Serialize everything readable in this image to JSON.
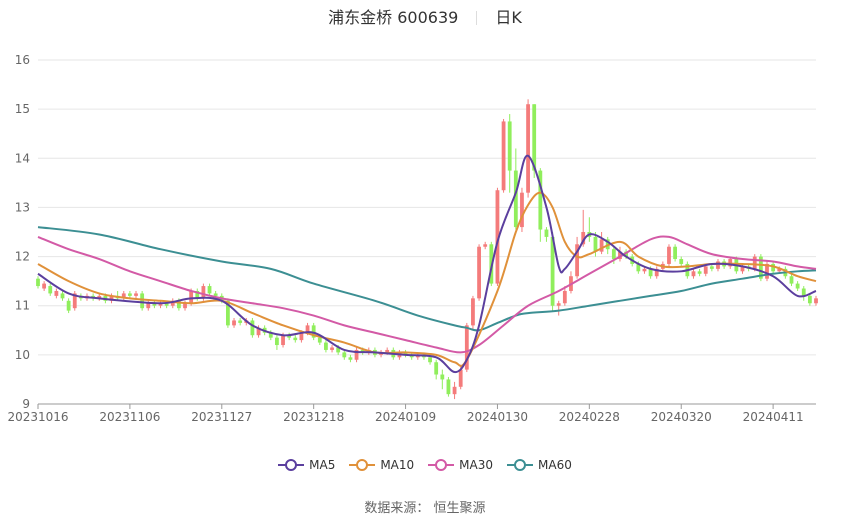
{
  "title": {
    "main": "浦东金桥 600639",
    "period": "日K"
  },
  "source_text": "数据来源： 恒生聚源",
  "colors": {
    "up": "#f47b7b",
    "down": "#90ee5c",
    "ma5": "#5b3f9e",
    "ma10": "#e0913a",
    "ma30": "#d35aa6",
    "ma60": "#3c8f93",
    "grid": "#e6e6e6"
  },
  "chart_data": {
    "type": "candlestick",
    "ylim": [
      9,
      16
    ],
    "yticks": [
      9,
      10,
      11,
      12,
      13,
      14,
      15,
      16
    ],
    "x_tick_labels": [
      "20231016",
      "20231106",
      "20231127",
      "20231218",
      "20240109",
      "20240130",
      "20240228",
      "20240320",
      "20240411"
    ],
    "x_tick_index": [
      0,
      15,
      30,
      45,
      60,
      75,
      90,
      105,
      120
    ],
    "legend": [
      "MA5",
      "MA10",
      "MA30",
      "MA60"
    ],
    "ohlc": [
      [
        11.55,
        11.4,
        11.6,
        11.35
      ],
      [
        11.35,
        11.45,
        11.5,
        11.3
      ],
      [
        11.4,
        11.25,
        11.45,
        11.2
      ],
      [
        11.2,
        11.3,
        11.35,
        11.15
      ],
      [
        11.25,
        11.15,
        11.3,
        11.1
      ],
      [
        11.1,
        10.9,
        11.15,
        10.85
      ],
      [
        10.95,
        11.25,
        11.3,
        10.9
      ],
      [
        11.2,
        11.15,
        11.25,
        11.1
      ],
      [
        11.15,
        11.2,
        11.25,
        11.1
      ],
      [
        11.2,
        11.15,
        11.25,
        11.1
      ],
      [
        11.15,
        11.2,
        11.25,
        11.1
      ],
      [
        11.2,
        11.1,
        11.25,
        11.05
      ],
      [
        11.1,
        11.2,
        11.25,
        11.05
      ],
      [
        11.2,
        11.15,
        11.3,
        11.1
      ],
      [
        11.15,
        11.25,
        11.3,
        11.1
      ],
      [
        11.25,
        11.2,
        11.3,
        11.15
      ],
      [
        11.2,
        11.25,
        11.3,
        11.15
      ],
      [
        11.25,
        10.95,
        11.3,
        10.9
      ],
      [
        10.95,
        11.05,
        11.1,
        10.9
      ],
      [
        11.05,
        11.0,
        11.1,
        10.95
      ],
      [
        11.0,
        11.05,
        11.1,
        10.95
      ],
      [
        11.05,
        11.0,
        11.1,
        10.95
      ],
      [
        11.0,
        11.1,
        11.15,
        10.95
      ],
      [
        11.1,
        10.95,
        11.15,
        10.9
      ],
      [
        10.95,
        11.05,
        11.1,
        10.9
      ],
      [
        11.05,
        11.3,
        11.35,
        11.0
      ],
      [
        11.3,
        11.15,
        11.35,
        11.1
      ],
      [
        11.15,
        11.4,
        11.45,
        11.1
      ],
      [
        11.4,
        11.25,
        11.45,
        11.2
      ],
      [
        11.25,
        11.2,
        11.3,
        11.1
      ],
      [
        11.2,
        11.1,
        11.25,
        11.05
      ],
      [
        11.1,
        10.6,
        11.15,
        10.55
      ],
      [
        10.6,
        10.7,
        10.75,
        10.55
      ],
      [
        10.7,
        10.65,
        10.75,
        10.6
      ],
      [
        10.65,
        10.7,
        10.75,
        10.6
      ],
      [
        10.7,
        10.4,
        10.75,
        10.35
      ],
      [
        10.4,
        10.55,
        10.6,
        10.35
      ],
      [
        10.55,
        10.45,
        10.6,
        10.4
      ],
      [
        10.45,
        10.35,
        10.5,
        10.3
      ],
      [
        10.35,
        10.2,
        10.4,
        10.1
      ],
      [
        10.2,
        10.4,
        10.45,
        10.15
      ],
      [
        10.4,
        10.35,
        10.45,
        10.3
      ],
      [
        10.35,
        10.3,
        10.4,
        10.25
      ],
      [
        10.3,
        10.45,
        10.5,
        10.25
      ],
      [
        10.45,
        10.6,
        10.65,
        10.4
      ],
      [
        10.6,
        10.35,
        10.65,
        10.3
      ],
      [
        10.35,
        10.25,
        10.4,
        10.2
      ],
      [
        10.25,
        10.1,
        10.3,
        10.05
      ],
      [
        10.1,
        10.15,
        10.2,
        10.05
      ],
      [
        10.15,
        10.05,
        10.2,
        10.0
      ],
      [
        10.05,
        9.95,
        10.1,
        9.9
      ],
      [
        9.95,
        9.9,
        10.0,
        9.85
      ],
      [
        9.9,
        10.1,
        10.15,
        9.85
      ],
      [
        10.1,
        10.05,
        10.15,
        10.0
      ],
      [
        10.05,
        10.1,
        10.15,
        10.0
      ],
      [
        10.1,
        10.0,
        10.15,
        9.95
      ],
      [
        10.0,
        10.05,
        10.1,
        9.95
      ],
      [
        10.05,
        10.1,
        10.15,
        10.0
      ],
      [
        10.1,
        9.95,
        10.15,
        9.9
      ],
      [
        9.95,
        10.05,
        10.1,
        9.9
      ],
      [
        10.05,
        10.0,
        10.1,
        9.95
      ],
      [
        10.0,
        9.95,
        10.05,
        9.9
      ],
      [
        9.95,
        10.0,
        10.05,
        9.9
      ],
      [
        10.0,
        9.95,
        10.05,
        9.9
      ],
      [
        9.95,
        9.85,
        10.0,
        9.8
      ],
      [
        9.85,
        9.6,
        9.9,
        9.5
      ],
      [
        9.6,
        9.5,
        9.7,
        9.3
      ],
      [
        9.5,
        9.2,
        9.55,
        9.15
      ],
      [
        9.2,
        9.35,
        9.45,
        9.1
      ],
      [
        9.35,
        9.7,
        9.8,
        9.3
      ],
      [
        9.7,
        10.6,
        10.65,
        9.65
      ],
      [
        10.6,
        11.15,
        11.2,
        10.5
      ],
      [
        11.15,
        12.2,
        12.25,
        11.1
      ],
      [
        12.2,
        12.25,
        12.3,
        12.15
      ],
      [
        12.25,
        11.45,
        12.3,
        11.4
      ],
      [
        11.45,
        13.35,
        13.4,
        11.4
      ],
      [
        13.35,
        14.75,
        14.8,
        13.3
      ],
      [
        14.75,
        13.75,
        14.9,
        13.3
      ],
      [
        13.75,
        12.6,
        14.2,
        12.55
      ],
      [
        12.6,
        13.3,
        13.4,
        12.5
      ],
      [
        13.3,
        15.1,
        15.2,
        13.2
      ],
      [
        15.1,
        13.75,
        15.1,
        13.6
      ],
      [
        13.75,
        12.55,
        13.8,
        12.3
      ],
      [
        12.55,
        12.4,
        12.6,
        12.3
      ],
      [
        12.4,
        11.0,
        12.5,
        10.9
      ],
      [
        11.0,
        11.05,
        11.1,
        10.8
      ],
      [
        11.05,
        11.3,
        11.4,
        11.0
      ],
      [
        11.3,
        11.6,
        11.7,
        11.25
      ],
      [
        11.6,
        12.25,
        12.4,
        11.55
      ],
      [
        12.25,
        12.5,
        12.95,
        12.2
      ],
      [
        12.5,
        12.4,
        12.8,
        12.3
      ],
      [
        12.4,
        12.1,
        12.5,
        12.0
      ],
      [
        12.1,
        12.35,
        12.5,
        12.05
      ],
      [
        12.35,
        12.15,
        12.4,
        12.05
      ],
      [
        12.15,
        11.95,
        12.2,
        11.85
      ],
      [
        11.95,
        12.1,
        12.2,
        11.9
      ],
      [
        12.1,
        12.0,
        12.15,
        11.95
      ],
      [
        12.0,
        11.85,
        12.05,
        11.8
      ],
      [
        11.85,
        11.7,
        11.9,
        11.65
      ],
      [
        11.7,
        11.75,
        11.8,
        11.65
      ],
      [
        11.75,
        11.6,
        11.8,
        11.55
      ],
      [
        11.6,
        11.75,
        11.8,
        11.55
      ],
      [
        11.75,
        11.85,
        11.9,
        11.7
      ],
      [
        11.85,
        12.2,
        12.25,
        11.8
      ],
      [
        12.2,
        11.95,
        12.25,
        11.9
      ],
      [
        11.95,
        11.85,
        12.0,
        11.8
      ],
      [
        11.85,
        11.6,
        11.9,
        11.55
      ],
      [
        11.6,
        11.7,
        11.75,
        11.55
      ],
      [
        11.7,
        11.65,
        11.75,
        11.6
      ],
      [
        11.65,
        11.8,
        11.85,
        11.6
      ],
      [
        11.8,
        11.75,
        11.85,
        11.7
      ],
      [
        11.75,
        11.9,
        11.95,
        11.7
      ],
      [
        11.9,
        11.8,
        11.95,
        11.75
      ],
      [
        11.8,
        11.95,
        12.0,
        11.75
      ],
      [
        11.95,
        11.7,
        12.0,
        11.65
      ],
      [
        11.7,
        11.8,
        11.85,
        11.65
      ],
      [
        11.8,
        11.75,
        11.85,
        11.7
      ],
      [
        11.75,
        12.0,
        12.05,
        11.7
      ],
      [
        12.0,
        11.55,
        12.05,
        11.5
      ],
      [
        11.55,
        11.85,
        11.9,
        11.5
      ],
      [
        11.85,
        11.7,
        11.9,
        11.65
      ],
      [
        11.7,
        11.75,
        11.8,
        11.65
      ],
      [
        11.75,
        11.6,
        11.8,
        11.55
      ],
      [
        11.6,
        11.45,
        11.65,
        11.4
      ],
      [
        11.45,
        11.35,
        11.5,
        11.3
      ],
      [
        11.35,
        11.2,
        11.4,
        11.1
      ],
      [
        11.2,
        11.05,
        11.25,
        11.0
      ],
      [
        11.05,
        11.15,
        11.2,
        11.0
      ]
    ],
    "ma_keypoints": {
      "MA5": [
        [
          0,
          11.65
        ],
        [
          5,
          11.25
        ],
        [
          10,
          11.15
        ],
        [
          20,
          11.05
        ],
        [
          25,
          11.15
        ],
        [
          30,
          11.1
        ],
        [
          35,
          10.6
        ],
        [
          40,
          10.4
        ],
        [
          45,
          10.45
        ],
        [
          50,
          10.1
        ],
        [
          55,
          10.05
        ],
        [
          60,
          10.0
        ],
        [
          65,
          9.95
        ],
        [
          68,
          9.65
        ],
        [
          70,
          9.9
        ],
        [
          72,
          10.6
        ],
        [
          75,
          12.3
        ],
        [
          78,
          13.3
        ],
        [
          80,
          14.05
        ],
        [
          83,
          13.0
        ],
        [
          85,
          11.8
        ],
        [
          86,
          11.75
        ],
        [
          88,
          12.1
        ],
        [
          90,
          12.45
        ],
        [
          93,
          12.3
        ],
        [
          96,
          12.0
        ],
        [
          100,
          11.75
        ],
        [
          105,
          11.7
        ],
        [
          110,
          11.85
        ],
        [
          115,
          11.8
        ],
        [
          120,
          11.6
        ],
        [
          124,
          11.2
        ],
        [
          127,
          11.3
        ]
      ],
      "MA10": [
        [
          0,
          11.85
        ],
        [
          5,
          11.5
        ],
        [
          10,
          11.25
        ],
        [
          15,
          11.15
        ],
        [
          20,
          11.1
        ],
        [
          25,
          11.05
        ],
        [
          30,
          11.1
        ],
        [
          35,
          10.85
        ],
        [
          40,
          10.6
        ],
        [
          45,
          10.4
        ],
        [
          50,
          10.25
        ],
        [
          55,
          10.05
        ],
        [
          60,
          10.05
        ],
        [
          65,
          10.0
        ],
        [
          68,
          9.85
        ],
        [
          70,
          9.9
        ],
        [
          75,
          11.3
        ],
        [
          78,
          12.5
        ],
        [
          80,
          13.05
        ],
        [
          82,
          13.3
        ],
        [
          84,
          13.0
        ],
        [
          86,
          12.3
        ],
        [
          88,
          12.0
        ],
        [
          90,
          12.05
        ],
        [
          95,
          12.3
        ],
        [
          98,
          12.0
        ],
        [
          102,
          11.8
        ],
        [
          106,
          11.8
        ],
        [
          110,
          11.85
        ],
        [
          115,
          11.85
        ],
        [
          120,
          11.8
        ],
        [
          124,
          11.6
        ],
        [
          127,
          11.5
        ]
      ],
      "MA30": [
        [
          0,
          12.4
        ],
        [
          5,
          12.15
        ],
        [
          10,
          11.95
        ],
        [
          15,
          11.7
        ],
        [
          20,
          11.5
        ],
        [
          25,
          11.3
        ],
        [
          30,
          11.15
        ],
        [
          35,
          11.05
        ],
        [
          40,
          10.95
        ],
        [
          45,
          10.8
        ],
        [
          50,
          10.6
        ],
        [
          55,
          10.45
        ],
        [
          60,
          10.3
        ],
        [
          65,
          10.15
        ],
        [
          69,
          10.05
        ],
        [
          72,
          10.2
        ],
        [
          76,
          10.6
        ],
        [
          80,
          11.0
        ],
        [
          85,
          11.3
        ],
        [
          90,
          11.65
        ],
        [
          95,
          12.0
        ],
        [
          100,
          12.35
        ],
        [
          103,
          12.4
        ],
        [
          106,
          12.25
        ],
        [
          110,
          12.05
        ],
        [
          115,
          11.95
        ],
        [
          120,
          11.9
        ],
        [
          124,
          11.8
        ],
        [
          127,
          11.75
        ]
      ],
      "MA60": [
        [
          0,
          12.6
        ],
        [
          10,
          12.45
        ],
        [
          20,
          12.15
        ],
        [
          30,
          11.9
        ],
        [
          38,
          11.75
        ],
        [
          45,
          11.45
        ],
        [
          55,
          11.1
        ],
        [
          62,
          10.8
        ],
        [
          68,
          10.6
        ],
        [
          70,
          10.55
        ],
        [
          72,
          10.5
        ],
        [
          75,
          10.65
        ],
        [
          78,
          10.8
        ],
        [
          80,
          10.85
        ],
        [
          85,
          10.9
        ],
        [
          90,
          11.0
        ],
        [
          95,
          11.1
        ],
        [
          100,
          11.2
        ],
        [
          105,
          11.3
        ],
        [
          110,
          11.45
        ],
        [
          115,
          11.55
        ],
        [
          120,
          11.65
        ],
        [
          124,
          11.7
        ],
        [
          127,
          11.72
        ]
      ]
    }
  }
}
